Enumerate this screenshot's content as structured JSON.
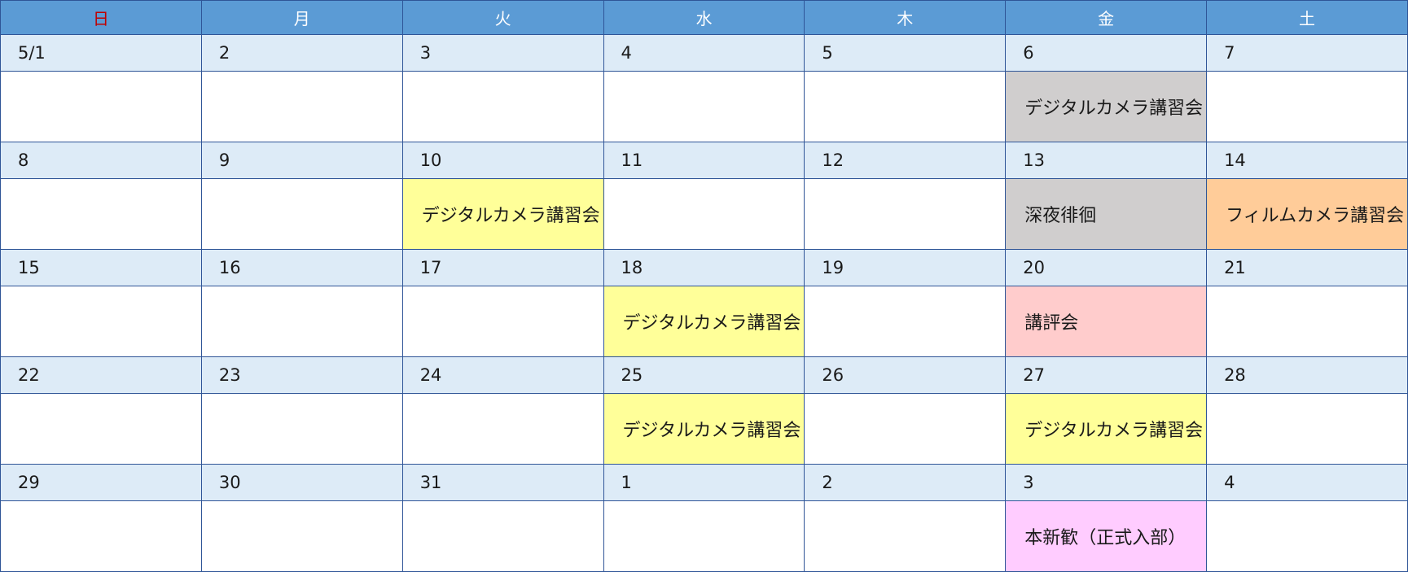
{
  "weekdays": [
    "日",
    "月",
    "火",
    "水",
    "木",
    "金",
    "土"
  ],
  "weeks": [
    {
      "dates": [
        "5/1",
        "2",
        "3",
        "4",
        "5",
        "6",
        "7"
      ],
      "events": [
        "",
        "",
        "",
        "",
        "",
        "デジタルカメラ講習会",
        ""
      ],
      "colors": [
        "",
        "",
        "",
        "",
        "",
        "gray",
        ""
      ]
    },
    {
      "dates": [
        "8",
        "9",
        "10",
        "11",
        "12",
        "13",
        "14"
      ],
      "events": [
        "",
        "",
        "デジタルカメラ講習会",
        "",
        "",
        "深夜徘徊",
        "フィルムカメラ講習会"
      ],
      "colors": [
        "",
        "",
        "yellow",
        "",
        "",
        "gray",
        "orange"
      ]
    },
    {
      "dates": [
        "15",
        "16",
        "17",
        "18",
        "19",
        "20",
        "21"
      ],
      "events": [
        "",
        "",
        "",
        "デジタルカメラ講習会",
        "",
        "講評会",
        ""
      ],
      "colors": [
        "",
        "",
        "",
        "yellow",
        "",
        "pink",
        ""
      ]
    },
    {
      "dates": [
        "22",
        "23",
        "24",
        "25",
        "26",
        "27",
        "28"
      ],
      "events": [
        "",
        "",
        "",
        "デジタルカメラ講習会",
        "",
        "デジタルカメラ講習会",
        ""
      ],
      "colors": [
        "",
        "",
        "",
        "yellow",
        "",
        "yellow",
        ""
      ]
    },
    {
      "dates": [
        "29",
        "30",
        "31",
        "1",
        "2",
        "3",
        "4"
      ],
      "events": [
        "",
        "",
        "",
        "",
        "",
        "本新歓（正式入部）",
        ""
      ],
      "colors": [
        "",
        "",
        "",
        "",
        "",
        "violet",
        ""
      ]
    }
  ],
  "palette": {
    "header": "#5b9bd5",
    "date_row": "#ddebf7",
    "sunday_text": "#c00000",
    "yellow": "#ffff99",
    "gray": "#d0cece",
    "orange": "#ffcc99",
    "pink": "#ffcccc",
    "violet": "#ffccff"
  }
}
